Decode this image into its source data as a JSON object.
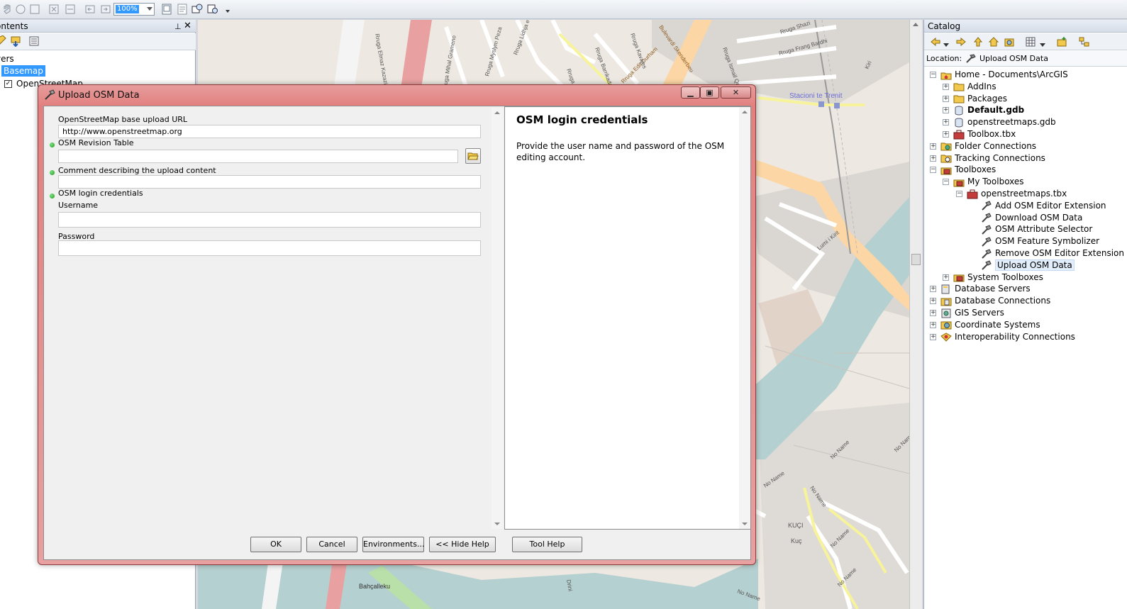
{
  "toolbar": {
    "zoom_value": "100%"
  },
  "toc": {
    "title": "ontents",
    "pin_glyph": "⊥",
    "close_glyph": "✕",
    "layers_label": "yers",
    "basemap_label": "Basemap",
    "osm_layer_label": "OpenStreetMap",
    "osm_layer_checked": true
  },
  "map": {
    "station_label": "Stacioni te Trenit",
    "street_labels": [
      "Bulevardi Skenderbeu",
      "Rruga Edit Durham",
      "Rruga Shazi",
      "Rruga Frang Bardhi",
      "Rruga Mihal Grameno",
      "Rruga Lidhja e Prizrenit",
      "Rruga Elmaz Kazazi",
      "Rruga Myslym Peza",
      "Rruga Barrikadave",
      "Rruga Dibres",
      "Rruga Ismail Qemali",
      "Rruga Kavajes",
      "Lumi i Kirit",
      "Kiri",
      "No Name",
      "No Name",
      "No Name",
      "No Name",
      "No Name",
      "No Name",
      "No Name",
      "KUÇI",
      "Kuç",
      "Bahçalleku",
      "Drini"
    ]
  },
  "catalog": {
    "title": "Catalog",
    "location_label": "Location:",
    "location_value": "Upload OSM Data",
    "tree": [
      {
        "label": "Home - Documents\\ArcGIS",
        "expander": "−",
        "icon": "home-folder-icon",
        "level": 0
      },
      {
        "label": "AddIns",
        "expander": "+",
        "icon": "folder-icon",
        "level": 1
      },
      {
        "label": "Packages",
        "expander": "+",
        "icon": "folder-icon",
        "level": 1
      },
      {
        "label": "Default.gdb",
        "expander": "+",
        "icon": "geodatabase-icon",
        "level": 1,
        "bold": true
      },
      {
        "label": "openstreetmaps.gdb",
        "expander": "+",
        "icon": "geodatabase-icon",
        "level": 1
      },
      {
        "label": "Toolbox.tbx",
        "expander": "+",
        "icon": "toolbox-icon",
        "level": 1
      },
      {
        "label": "Folder Connections",
        "expander": "+",
        "icon": "folder-connection-icon",
        "level": 0
      },
      {
        "label": "Tracking Connections",
        "expander": "+",
        "icon": "tracking-connection-icon",
        "level": 0
      },
      {
        "label": "Toolboxes",
        "expander": "−",
        "icon": "toolboxes-icon",
        "level": 0
      },
      {
        "label": "My Toolboxes",
        "expander": "−",
        "icon": "toolboxes-icon",
        "level": 1
      },
      {
        "label": "openstreetmaps.tbx",
        "expander": "−",
        "icon": "toolbox-icon",
        "level": 2
      },
      {
        "label": "Add OSM Editor Extension",
        "expander": "",
        "icon": "hammer-tool-icon",
        "level": 3
      },
      {
        "label": "Download OSM Data",
        "expander": "",
        "icon": "hammer-tool-icon",
        "level": 3
      },
      {
        "label": "OSM Attribute Selector",
        "expander": "",
        "icon": "hammer-tool-icon",
        "level": 3
      },
      {
        "label": "OSM Feature Symbolizer",
        "expander": "",
        "icon": "hammer-tool-icon",
        "level": 3
      },
      {
        "label": "Remove OSM Editor Extension",
        "expander": "",
        "icon": "hammer-tool-icon",
        "level": 3
      },
      {
        "label": "Upload OSM Data",
        "expander": "",
        "icon": "hammer-tool-icon",
        "level": 3,
        "selected": true
      },
      {
        "label": "System Toolboxes",
        "expander": "+",
        "icon": "toolboxes-icon",
        "level": 1
      },
      {
        "label": "Database Servers",
        "expander": "+",
        "icon": "database-server-icon",
        "level": 0
      },
      {
        "label": "Database Connections",
        "expander": "+",
        "icon": "database-connection-icon",
        "level": 0
      },
      {
        "label": "GIS Servers",
        "expander": "+",
        "icon": "gis-server-icon",
        "level": 0
      },
      {
        "label": "Coordinate Systems",
        "expander": "+",
        "icon": "coordinate-system-icon",
        "level": 0
      },
      {
        "label": "Interoperability Connections",
        "expander": "+",
        "icon": "interop-connection-icon",
        "level": 0
      }
    ]
  },
  "dialog": {
    "title": "Upload OSM Data",
    "minimize_glyph": "▁",
    "maximize_glyph": "▣",
    "close_glyph": "✕",
    "params": {
      "url_label": "OpenStreetMap base upload URL",
      "url_value": "http://www.openstreetmap.org",
      "revision_label": "OSM Revision Table",
      "revision_value": "",
      "comment_label": "Comment describing the upload content",
      "comment_value": "",
      "credentials_label": "OSM login credentials",
      "username_label": "Username",
      "username_value": "",
      "password_label": "Password",
      "password_value": ""
    },
    "help": {
      "title": "OSM login credentials",
      "text": "Provide the user name and password of the OSM editing account."
    },
    "buttons": {
      "ok": "OK",
      "cancel": "Cancel",
      "environments": "Environments...",
      "hide_help": "<< Hide Help",
      "tool_help": "Tool Help"
    }
  },
  "colors": {
    "selection": "#3399ff",
    "dialog_frame": "#e2807f",
    "required_dot": "#1c9a1c",
    "map_water": "#b5d0d0",
    "map_major_road": "#fcd6a4",
    "map_primary_road": "#e8a0a0"
  }
}
